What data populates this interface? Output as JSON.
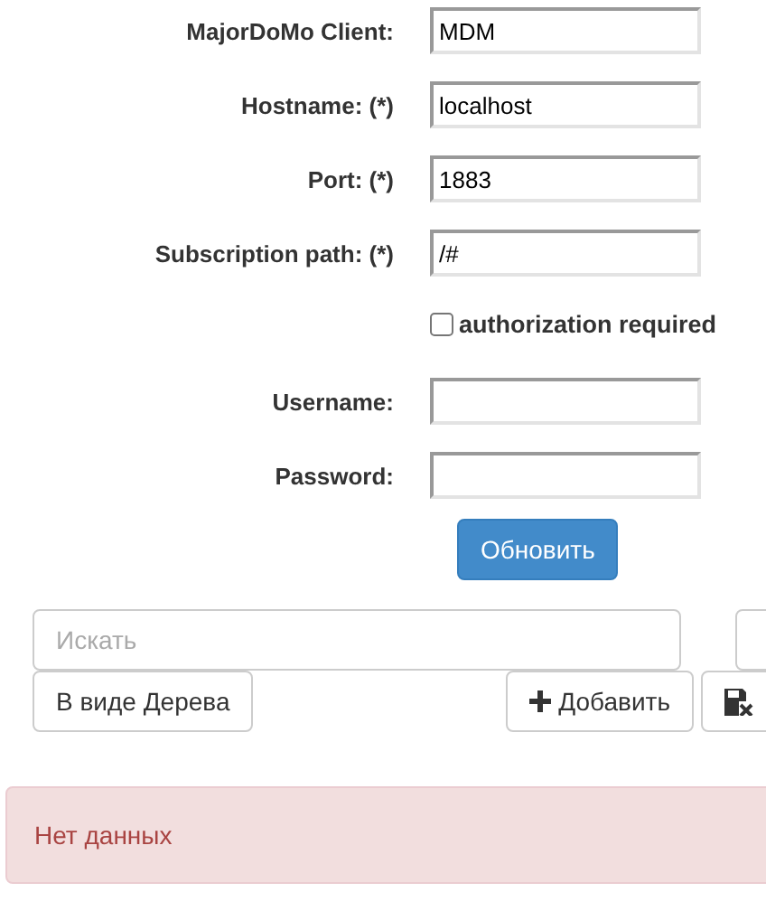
{
  "form": {
    "fields": [
      {
        "label": "MajorDoMo Client:",
        "value": "MDM"
      },
      {
        "label": "Hostname: (*)",
        "value": "localhost"
      },
      {
        "label": "Port: (*)",
        "value": "1883"
      },
      {
        "label": "Subscription path: (*)",
        "value": "/#"
      }
    ],
    "authorization": {
      "label": "authorization required",
      "checked": false
    },
    "credentials": [
      {
        "label": "Username:"
      },
      {
        "label": "Password:"
      }
    ],
    "submit": "Обновить"
  },
  "toolbar": {
    "search": {
      "placeholder": "Искать"
    },
    "tree_button": "В виде Дерева",
    "add_button": "Добавить"
  },
  "alert": {
    "text": "Нет данных"
  }
}
